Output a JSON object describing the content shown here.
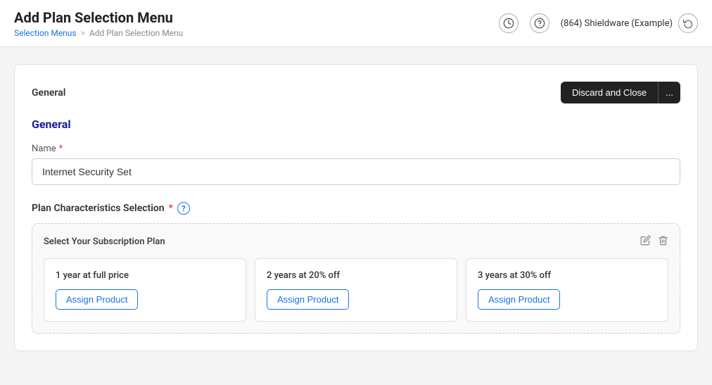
{
  "header": {
    "title": "Add Plan Selection Menu",
    "breadcrumb": {
      "parent_label": "Selection Menus",
      "separator": ">",
      "current": "Add Plan Selection Menu"
    },
    "company": "(864) Shieldware (Example)",
    "history_icon": "⏱",
    "help_icon": "?",
    "switch_icon": "↩"
  },
  "card": {
    "header_label": "General",
    "discard_button": "Discard and Close",
    "more_button": "..."
  },
  "general_section": {
    "title": "General",
    "name_label": "Name",
    "name_required": "*",
    "name_value": "Internet Security Set",
    "name_placeholder": "Internet Security Set"
  },
  "plan_section": {
    "label": "Plan Characteristics Selection",
    "required": "*",
    "help_icon_label": "?",
    "subscription_box": {
      "title": "Select Your Subscription Plan",
      "edit_icon": "✏",
      "delete_icon": "🗑",
      "plans": [
        {
          "title": "1 year at full price",
          "assign_button": "Assign Product"
        },
        {
          "title": "2 years at 20% off",
          "assign_button": "Assign Product"
        },
        {
          "title": "3 years at 30% off",
          "assign_button": "Assign Product"
        }
      ]
    }
  }
}
